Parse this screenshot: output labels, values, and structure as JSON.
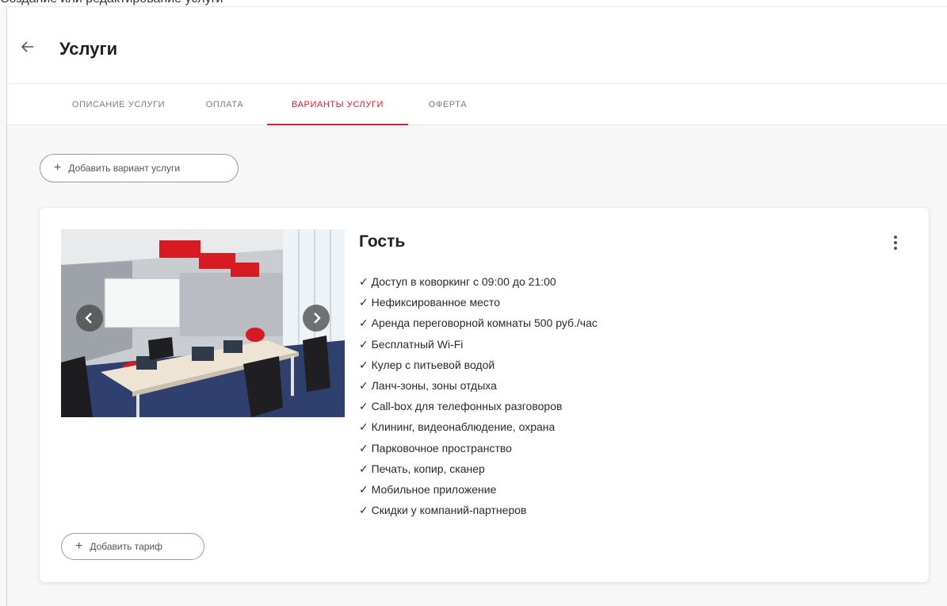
{
  "top_strip_text": "Создание или редактирование услуги",
  "header": {
    "title": "Услуги"
  },
  "tabs": [
    {
      "label": "ОПИСАНИЕ УСЛУГИ",
      "active": false
    },
    {
      "label": "ОПЛАТА",
      "active": false
    },
    {
      "label": "ВАРИАНТЫ УСЛУГИ",
      "active": true
    },
    {
      "label": "ОФЕРТА",
      "active": false
    }
  ],
  "add_variant_label": "Добавить вариант услуги",
  "variant": {
    "title": "Гость",
    "features": [
      "✓ Доступ в коворкинг с 09:00 до 21:00",
      "✓ Нефиксированное место",
      "✓ Аренда переговорной комнаты 500 руб./час",
      "✓ Бесплатный Wi-Fi",
      "✓ Кулер с питьевой водой",
      "✓ Ланч-зоны, зоны отдыха",
      "✓ Call-box для телефонных разговоров",
      "✓ Клининг, видеонаблюдение, охрана",
      "✓ Парковочное пространство",
      "✓ Печать, копир, сканер",
      "✓ Мобильное приложение",
      "✓ Скидки у компаний-партнеров"
    ],
    "add_tariff_label": "Добавить тариф"
  },
  "colors": {
    "accent": "#d81b2e",
    "background": "#f7f7f8"
  },
  "icons": {
    "back": "arrow-left-icon",
    "plus": "plus-icon",
    "menu": "more-vertical-icon",
    "prev": "chevron-left-icon",
    "next": "chevron-right-icon"
  }
}
